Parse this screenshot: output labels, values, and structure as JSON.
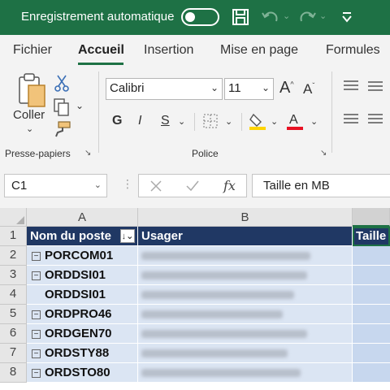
{
  "titlebar": {
    "autosave_label": "Enregistrement automatique",
    "autosave_on": false
  },
  "menu": {
    "tabs": [
      "Fichier",
      "Accueil",
      "Insertion",
      "Mise en page",
      "Formules"
    ],
    "active": "Accueil"
  },
  "ribbon": {
    "paste_label": "Coller",
    "clipboard_group": "Presse-papiers",
    "font_group": "Police",
    "font_name": "Calibri",
    "font_size": "11",
    "bold": "G",
    "italic": "I",
    "underline": "S",
    "grow_font": "A",
    "shrink_font": "A",
    "highlight_color": "#ffd400",
    "font_color": "#e81123"
  },
  "formula_bar": {
    "name_box": "C1",
    "fx": "fx",
    "content": "Taille en MB"
  },
  "sheet": {
    "columns": [
      "A",
      "B"
    ],
    "rows": [
      "1",
      "2",
      "3",
      "4",
      "5",
      "6",
      "7",
      "8"
    ],
    "headers": {
      "a": "Nom du poste",
      "b": "Usager",
      "c": "Taille"
    },
    "cells_a": [
      "PORCOM01",
      "ORDDSI01",
      "ORDDSI01",
      "ORDPRO46",
      "ORDGEN70",
      "ORDSTY88",
      "ORDSTO80"
    ],
    "grouped": [
      true,
      true,
      false,
      true,
      true,
      true,
      true
    ]
  }
}
